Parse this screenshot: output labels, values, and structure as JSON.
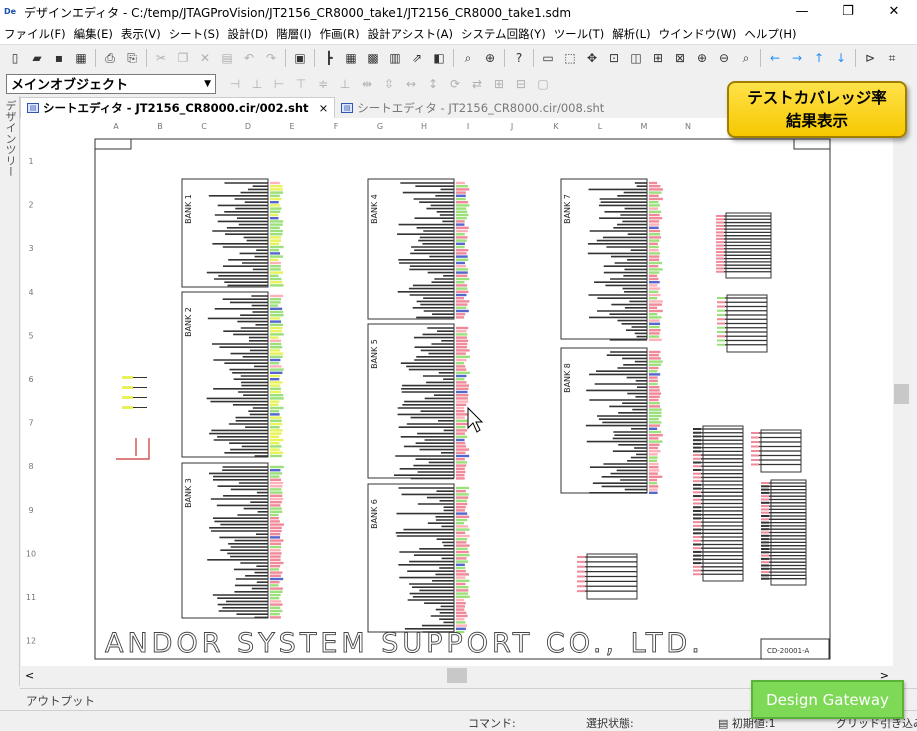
{
  "window": {
    "app_icon": "De",
    "title": "デザインエディタ - C:/temp/JTAGProVision/JT2156_CR8000_take1/JT2156_CR8000_take1.sdm",
    "minimize": "—",
    "restore": "❐",
    "close": "✕"
  },
  "menu": [
    "ファイル(F)",
    "編集(E)",
    "表示(V)",
    "シート(S)",
    "設計(D)",
    "階層(I)",
    "作画(R)",
    "設計アシスト(A)",
    "システム回路(Y)",
    "ツール(T)",
    "解析(L)",
    "ウインドウ(W)",
    "ヘルプ(H)"
  ],
  "toolbar2": {
    "object_select": "メインオブジェクト"
  },
  "sidebar": {
    "tab": "デザインツリー"
  },
  "tabs": [
    {
      "label": "シートエディタ - JT2156_CR8000.cir/002.sht",
      "close": "×"
    },
    {
      "label": "シートエディタ - JT2156_CR8000.cir/008.sht"
    }
  ],
  "callout": {
    "line1": "テストカバレッジ率",
    "line2": "結果表示"
  },
  "sheet": {
    "columns": [
      "A",
      "B",
      "C",
      "D",
      "E",
      "F",
      "G",
      "H",
      "I",
      "J",
      "K",
      "L",
      "M",
      "N"
    ],
    "rows": [
      "1",
      "2",
      "3",
      "4",
      "5",
      "6",
      "7",
      "8",
      "9",
      "10",
      "11",
      "12"
    ],
    "banks": [
      "BANK 1",
      "BANK 2",
      "BANK 3",
      "BANK 4",
      "BANK 5",
      "BANK 6",
      "BANK 7",
      "BANK 8"
    ],
    "company": "ANDOR SYSTEM SUPPORT CO., LTD.",
    "titleblock": "CD-20001-A"
  },
  "scroll": {
    "left": "<",
    "right": ">"
  },
  "output": {
    "label": "アウトプット"
  },
  "status": {
    "command": "コマンド:",
    "selection": "選択状態:",
    "initial": "初期値:",
    "initial_value": "1",
    "grid": "グリッド引き込み"
  },
  "watermark": {
    "text": "Design Gateway"
  }
}
